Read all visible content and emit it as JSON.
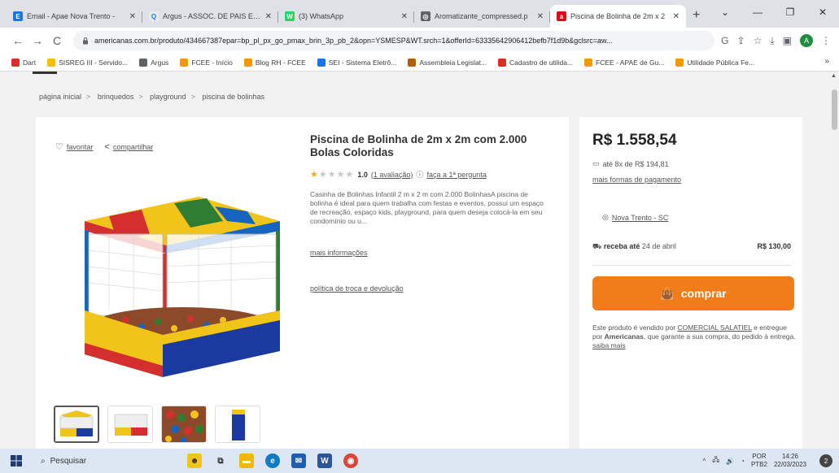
{
  "browser": {
    "tabs": [
      {
        "title": "Email - Apae Nova Trento - ",
        "color": "#1a73e8",
        "glyph": "E"
      },
      {
        "title": "Argus - ASSOC. DE PAIS E AM",
        "color": "#e8eaed",
        "glyph": "Q"
      },
      {
        "title": "(3) WhatsApp",
        "color": "#25d366",
        "glyph": "W"
      },
      {
        "title": "Aromatizante_compressed.p",
        "color": "#5f6368",
        "glyph": "◎"
      },
      {
        "title": "Piscina de Bolinha de 2m x 2",
        "color": "#e60014",
        "glyph": "a"
      }
    ],
    "new_tab_symbol": "+",
    "window_controls": [
      "⌄",
      "—",
      "❐",
      "✕"
    ],
    "nav": {
      "back": "←",
      "forward": "→",
      "reload": "C"
    },
    "url": "americanas.com.br/produto/434667387epar=bp_pl_px_go_pmax_brin_3p_pb_2&opn=YSMESP&WT.srch=1&offerId=63335642906412befb7f1d9b&gclsrc=aw...",
    "toolbar_icons": [
      "G",
      "⇪",
      "☆",
      "⤓",
      "▣"
    ],
    "profile_initial": "A",
    "bookmarks": [
      {
        "label": "Dart",
        "color": "#d93025"
      },
      {
        "label": "SISREG III - Servido...",
        "color": "#fbbc04"
      },
      {
        "label": "Argus",
        "color": "#5f6368"
      },
      {
        "label": "FCEE - Início",
        "color": "#f29900"
      },
      {
        "label": "Blog RH - FCEE",
        "color": "#f29900"
      },
      {
        "label": "SEI - Sistema Eletrô...",
        "color": "#1a73e8"
      },
      {
        "label": "Assembleia Legislat...",
        "color": "#b06000"
      },
      {
        "label": "Cadastro de utilida...",
        "color": "#d93025"
      },
      {
        "label": "FCEE - APAE de Gu...",
        "color": "#f29900"
      },
      {
        "label": "Utilidade Pública Fe...",
        "color": "#f29900"
      }
    ],
    "bookmarks_more": "»"
  },
  "page": {
    "breadcrumb": [
      "página inicial",
      "brinquedos",
      "playground",
      "piscina de bolinhas"
    ],
    "breadcrumb_sep": ">",
    "favorite_label": "favoritar",
    "share_label": "compartilhar",
    "product_title": "Piscina de Bolinha de 2m x 2m com 2.000 Bolas Coloridas",
    "rating_value": "1.0",
    "rating_stars": 1,
    "rating_count_label": "(1 avaliação)",
    "question_label": "faça a 1ª pergunta",
    "description": "Casinha de Bolinhas Infantil 2 m x 2 m com 2.000 BolinhasA piscina de bolinha é ideal para quem trabalha com festas e eventos, possui um espaço de recreação, espaço kids, playground, para quem deseja colocá-la em seu condomínio ou u...",
    "more_info": "mais informações",
    "return_policy": "política de troca e devolução",
    "price": "R$ 1.558,54",
    "installments": "até 8x de R$ 194,81",
    "payment_options": "mais formas de pagamento",
    "location": "Nova Trento - SC",
    "shipping_label": "receba até",
    "shipping_date": "24 de abril",
    "shipping_price": "R$ 130,00",
    "buy_label": "comprar",
    "seller_prefix": "Este produto é vendido por",
    "seller_name": "COMERCIAL SALATIEL",
    "seller_mid": "e entregue por",
    "deliverer": "Americanas",
    "seller_suffix": ", que garante a sua compra, do pedido à entrega.",
    "learn_more": "saiba mais",
    "accent_color": "#f07d1a"
  },
  "taskbar": {
    "search_placeholder": "Pesquisar",
    "lang_line1": "POR",
    "lang_line2": "PTB2",
    "time": "14:26",
    "date": "22/03/2023",
    "notification_count": "2"
  }
}
